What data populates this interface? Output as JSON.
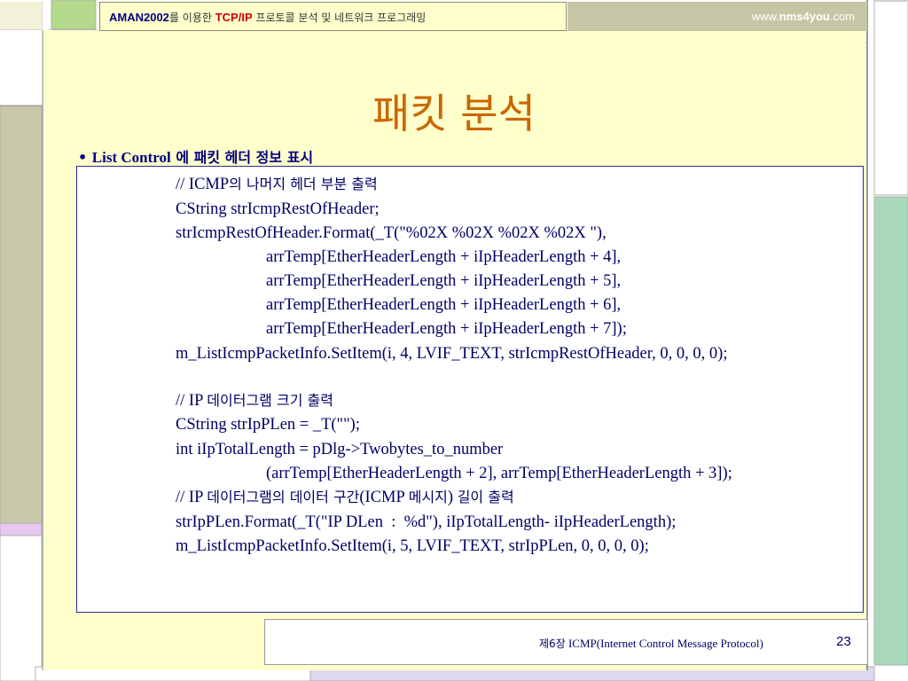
{
  "header": {
    "brand": "AMAN2002",
    "text_after_brand": "를 이용한 ",
    "protocol": "TCP/IP",
    "text_after_protocol": " 프로토콜 분석 및 네트워크 프로그래밍",
    "url_prefix": "www.",
    "url_bold": "nms4you",
    "url_suffix": ".com"
  },
  "slide": {
    "title": "패킷 분석",
    "bullet_marker": "• ",
    "bullet_en": "List Control",
    "bullet_ko": " 에 패킷 헤더 정보 표시"
  },
  "code": {
    "line1_prefix": "// ICMP",
    "line1_ko": "의 나머지 헤더 부분 출력",
    "line2": "CString strIcmpRestOfHeader;",
    "line3": "strIcmpRestOfHeader.Format(_T(\"%02X %02X %02X %02X \"),",
    "line4": "arrTemp[EtherHeaderLength + iIpHeaderLength + 4],",
    "line5": "arrTemp[EtherHeaderLength + iIpHeaderLength + 5],",
    "line6": "arrTemp[EtherHeaderLength + iIpHeaderLength + 6],",
    "line7": "arrTemp[EtherHeaderLength + iIpHeaderLength + 7]);",
    "line8": "m_ListIcmpPacketInfo.SetItem(i, 4, LVIF_TEXT, strIcmpRestOfHeader, 0, 0, 0, 0);",
    "line9_prefix": "// IP ",
    "line9_ko": "데이터그램 크기 출력",
    "line10": "CString strIpPLen = _T(\"\");",
    "line11": "int iIpTotalLength = pDlg->Twobytes_to_number",
    "line12": "(arrTemp[EtherHeaderLength + 2], arrTemp[EtherHeaderLength + 3]);",
    "line13_prefix": "// IP ",
    "line13_ko1": "데이터그램의 데이터 구간",
    "line13_mid": "(ICMP ",
    "line13_ko2": "메시지",
    "line13_mid2": ") ",
    "line13_ko3": "길이 출력",
    "line14": "strIpPLen.Format(_T(\"IP DLen  :  %d\"), iIpTotalLength- iIpHeaderLength);",
    "line15": "m_ListIcmpPacketInfo.SetItem(i, 5, LVIF_TEXT, strIpPLen, 0, 0, 0, 0);"
  },
  "footer": {
    "chapter_ko": "제6장",
    "chapter_title": "  ICMP(Internet Control Message Protocol)",
    "page_number": "23"
  }
}
